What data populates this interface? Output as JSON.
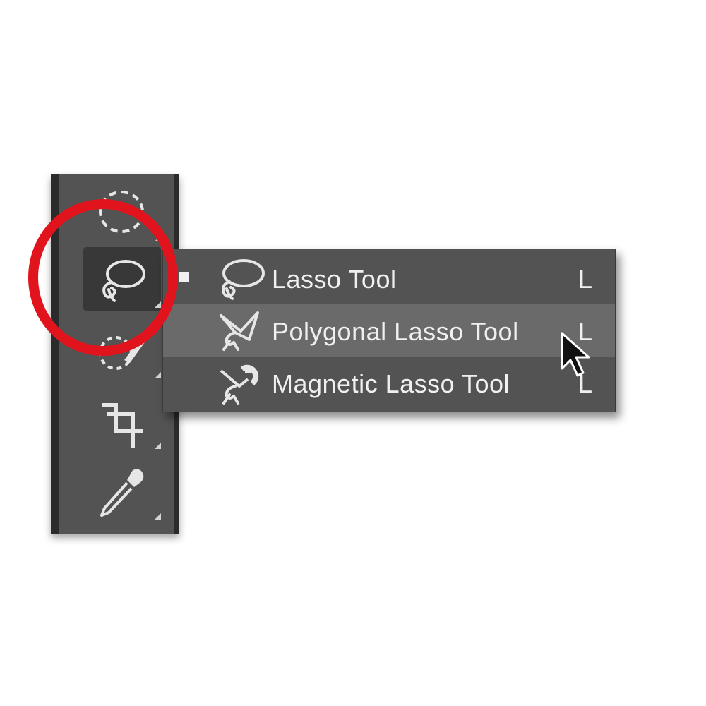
{
  "toolbar": {
    "tools": [
      {
        "name": "elliptical-marquee-tool"
      },
      {
        "name": "lasso-tool",
        "active": true
      },
      {
        "name": "quick-selection-tool"
      },
      {
        "name": "crop-tool"
      },
      {
        "name": "eyedropper-tool"
      }
    ]
  },
  "flyout": {
    "items": [
      {
        "label": "Lasso Tool",
        "shortcut": "L",
        "icon": "lasso-icon",
        "selected": true
      },
      {
        "label": "Polygonal Lasso Tool",
        "shortcut": "L",
        "icon": "polygonal-lasso-icon",
        "hovered": true
      },
      {
        "label": "Magnetic Lasso Tool",
        "shortcut": "L",
        "icon": "magnetic-lasso-icon"
      }
    ]
  },
  "colors": {
    "annotation": "#e1131c",
    "panel": "#535353",
    "highlight": "#6a6a6a"
  }
}
